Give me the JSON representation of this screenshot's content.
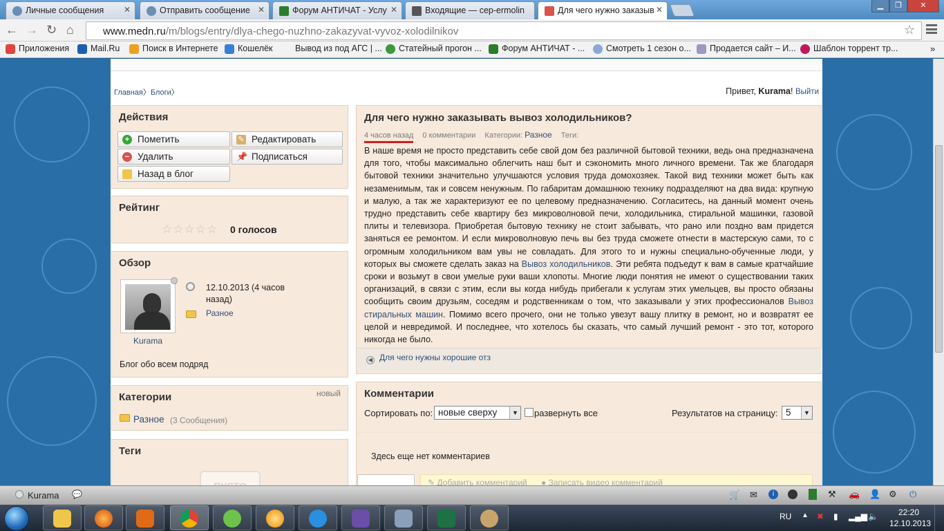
{
  "tabs": [
    {
      "label": "Личные сообщения",
      "active": false
    },
    {
      "label": "Отправить сообщение",
      "active": false
    },
    {
      "label": "Форум АНТИЧАТ - Услу",
      "active": false
    },
    {
      "label": "Входящие — cep-ermolin",
      "active": false
    },
    {
      "label": "Для чего нужно заказыв",
      "active": true
    }
  ],
  "toolbar": {
    "url_host": "www.medn.ru",
    "url_path": "/m/blogs/entry/dlya-chego-nuzhno-zakazyvat-vyvoz-xolodilnikov"
  },
  "bookmarks": [
    {
      "label": "Приложения",
      "color": "#e0463c"
    },
    {
      "label": "Mail.Ru",
      "color": "#1b5fb2"
    },
    {
      "label": "Поиск в Интернете",
      "color": "#f0a020"
    },
    {
      "label": "Кошелёк",
      "color": "#3a7fd6"
    },
    {
      "label": "Вывод из под АГС | ...",
      "color": ""
    },
    {
      "label": "Статейный прогон ...",
      "color": "#3c9a3c"
    },
    {
      "label": "Форум АНТИЧАТ - ...",
      "color": "#2b7d2b"
    },
    {
      "label": "Смотреть 1 сезон о...",
      "color": "#8aa9d8"
    },
    {
      "label": "Продается сайт – И...",
      "color": "#9a9abf"
    },
    {
      "label": "Шаблон торрент тр...",
      "color": "#c2185b"
    }
  ],
  "breadcrumb": {
    "home": "Главная",
    "blogs": "Блоги"
  },
  "greeting": {
    "prefix": "Привет,",
    "user": "Kurama",
    "suffix": "!",
    "logout": "Выйти"
  },
  "actions": {
    "title": "Действия",
    "mark": "Пометить",
    "edit": "Редактировать",
    "delete": "Удалить",
    "subscribe": "Подписаться",
    "back": "Назад в блог"
  },
  "rating": {
    "title": "Рейтинг",
    "stars": "☆☆☆☆☆",
    "votes": "0 голосов"
  },
  "overview": {
    "title": "Обзор",
    "date": "12.10.2013 (4 часов назад)",
    "category": "Разное",
    "username": "Kurama",
    "blog_desc": "Блог обо всем подряд"
  },
  "categories": {
    "title": "Категории",
    "badge": "новый",
    "item": "Разное",
    "count": "(3 Сообщения)"
  },
  "tags": {
    "title": "Теги",
    "empty": "ПУСТО"
  },
  "article": {
    "title": "Для чего нужно заказывать вывоз холодильников?",
    "ago": "4 часов назад",
    "comments": "0 комментарии",
    "category_label": "Категории:",
    "category": "Разное",
    "tags_label": "Теги:",
    "p1": "В наше время не просто представить себе свой дом без различной бытовой техники, ведь она предназначена для того, чтобы максимально облегчить наш быт и сэкономить много личного времени. Так же благодаря бытовой техники значительно улучшаются условия труда домохозяек. Такой вид техники может быть как незаменимым, так и совсем ненужным. По габаритам домашнюю технику подразделяют на два вида: крупную и малую, а так же характеризуют ее по целевому предназначению. Согласитесь, на данный момент очень трудно представить себе квартиру без микроволновой печи, холодильника, стиральной машинки, газовой плиты и телевизора. Приобретая бытовую технику не стоит забывать, что рано или поздно вам придется заняться ее ремонтом. И если микроволновую печь вы без труда сможете отнести в мастерскую сами, то с огромным холодильником вам увы не совладать. Для этого то и нужны специально-обученные люди, у которых вы сможете сделать заказ на ",
    "link1": "Вывоз холодильников",
    "p2": ". Эти ребята подъедут к вам в самые кратчайшие сроки и возьмут в свои умелые руки ваши хлопоты. Многие люди понятия не имеют о существовании таких организаций, в связи с этим, если вы когда нибудь прибегали к услугам этих умельцев, вы просто обязаны сообщить своим друзьям, соседям и родственникам о том, что заказывали у этих профессионалов ",
    "link2": "Вывоз стиральных машин",
    "p3": ". Помимо всего прочего, они не только увезут вашу плитку в ремонт, но и возвратят ее целой и невредимой. И последнее, что хотелось бы сказать, что самый лучший ремонт - это тот, которого никогда не было.",
    "prev_link": "Для чего нужны хорошие отз"
  },
  "comments": {
    "title": "Комментарии",
    "sort_label": "Сортировать по:",
    "sort_value": "новые сверху",
    "expand": "развернуть все",
    "per_page_label": "Результатов на страницу:",
    "per_page_value": "5",
    "empty": "Здесь еще нет комментариев",
    "add": "Добавить комментарий",
    "video": "Записать видео комментарий"
  },
  "userbar": {
    "name": "Kurama"
  },
  "tray": {
    "lang": "RU",
    "time": "22:20",
    "date": "12.10.2013"
  },
  "colors": {
    "link": "#2d4f7a",
    "panel_bg": "#f7e9dc",
    "underline": "#d21e1e"
  }
}
